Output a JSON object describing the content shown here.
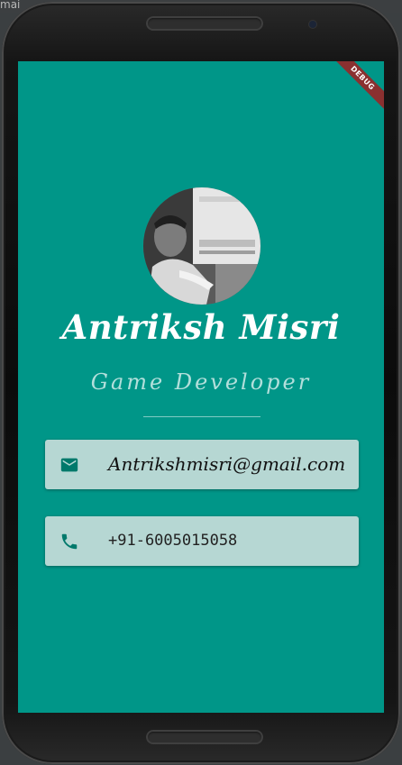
{
  "host_window": {
    "title_fragment": "mai"
  },
  "app": {
    "debug_banner": "DEBUG",
    "profile": {
      "name": "Antriksh Misri",
      "title": "Game Developer",
      "avatar_alt": "profile-photo"
    },
    "contacts": [
      {
        "type": "email",
        "icon": "email-icon",
        "value": "Antrikshmisri@gmail.com"
      },
      {
        "type": "phone",
        "icon": "phone-icon",
        "value": "+91-6005015058"
      }
    ]
  },
  "colors": {
    "background": "#009688",
    "card": "#b6d7d3",
    "icon": "#00796b",
    "name_text": "#ffffff",
    "title_text": "#b2dfdb",
    "debug_ribbon": "#8a3030"
  }
}
